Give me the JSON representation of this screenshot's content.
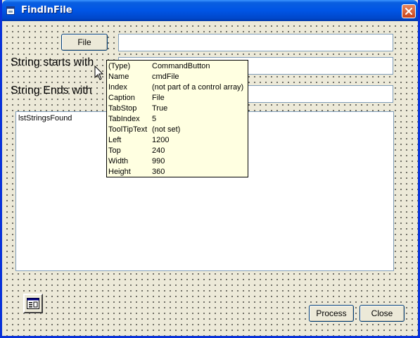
{
  "window": {
    "title": "FindInFile",
    "title_icon": "form-icon",
    "close_icon": "close-icon",
    "colors": {
      "titlebar": "#0055e5",
      "close_button": "#d9582e",
      "face": "#ece9d8",
      "tooltip_bg": "#ffffe1"
    }
  },
  "form": {
    "file_button_label": "File",
    "starts_label": "String starts with",
    "ends_label": "String Ends with",
    "list_name": "lstStringsFound",
    "process_label": "Process",
    "close_label": "Close",
    "common_dialog_icon": "common-dialog-control-icon"
  },
  "tooltip": {
    "rows": [
      {
        "key": "(Type)",
        "value": "CommandButton"
      },
      {
        "key": "Name",
        "value": "cmdFile"
      },
      {
        "key": "Index",
        "value": "(not part of a control array)"
      },
      {
        "key": "Caption",
        "value": "File"
      },
      {
        "key": "TabStop",
        "value": "True"
      },
      {
        "key": "TabIndex",
        "value": "5"
      },
      {
        "key": "ToolTipText",
        "value": "(not set)"
      },
      {
        "key": "Left",
        "value": "1200"
      },
      {
        "key": "Top",
        "value": "240"
      },
      {
        "key": "Width",
        "value": "990"
      },
      {
        "key": "Height",
        "value": "360"
      }
    ]
  }
}
